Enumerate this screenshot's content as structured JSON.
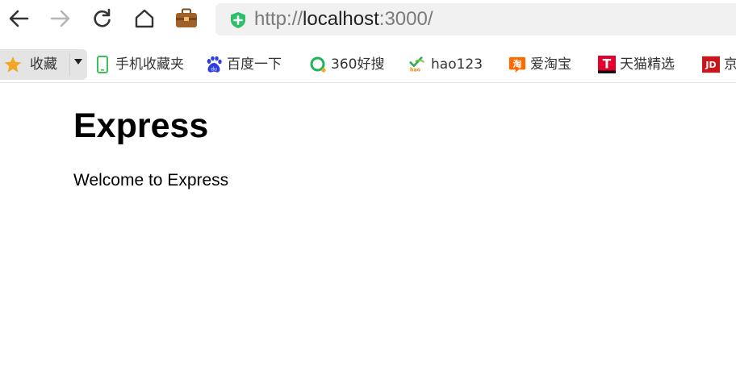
{
  "browser": {
    "nav_icons": [
      "back-arrow-icon",
      "forward-arrow-icon",
      "reload-icon",
      "home-icon",
      "wallet-icon"
    ],
    "address": {
      "scheme": "http://",
      "host": "localhost",
      "rest": ":3000/",
      "security_icon": "shield-plus-icon",
      "security_color": "#2fbf6a"
    }
  },
  "bookmarks": {
    "favorites_label": "收藏",
    "items": [
      {
        "label": "手机收藏夹",
        "icon": "phone-icon"
      },
      {
        "label": "百度一下",
        "icon": "baidu-paw-icon"
      },
      {
        "label": "360好搜",
        "icon": "360-search-icon"
      },
      {
        "label": "hao123",
        "icon": "hao123-icon"
      },
      {
        "label": "爱淘宝",
        "icon": "taobao-icon"
      },
      {
        "label": "天猫精选",
        "icon": "tmall-icon"
      },
      {
        "label": "京",
        "icon": "jd-icon"
      }
    ]
  },
  "page": {
    "title": "Express",
    "message": "Welcome to Express"
  },
  "colors": {
    "star": "#f5a623",
    "phone": "#3fbf5a",
    "baidu": "#2d3ee0",
    "taobao": "#ff6a00",
    "tmall": "#e4002b",
    "jd": "#c8161d"
  }
}
